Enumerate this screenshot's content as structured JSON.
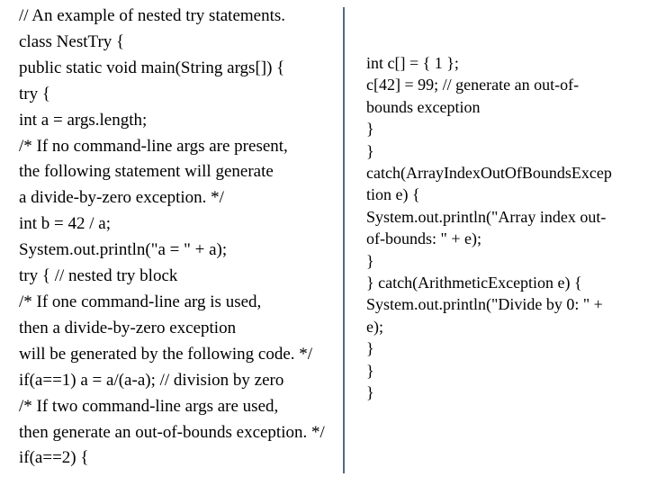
{
  "slide": {
    "left_column": {
      "lines": [
        "// An example of nested try statements.",
        "class NestTry {",
        "public static void main(String args[]) {",
        "try {",
        "int a = args.length;",
        "/* If no command-line args are present,",
        "the following statement will generate",
        "a divide-by-zero exception. */",
        "int b = 42 / a;",
        "System.out.println(\"a = \" + a);",
        "try { // nested try block",
        "/* If one command-line arg is used,",
        "then a divide-by-zero exception",
        "will be generated by the following code. */",
        "if(a==1) a = a/(a-a); // division by zero",
        "/* If two command-line args are used,",
        "then generate an out-of-bounds exception. */",
        "if(a==2) {"
      ]
    },
    "right_column": {
      "lines": [
        "int c[] = { 1 };",
        "c[42] = 99; // generate an out-of-",
        "bounds exception",
        "}",
        "}",
        "catch(ArrayIndexOutOfBoundsExcep",
        "tion e) {",
        "System.out.println(\"Array index out-",
        "of-bounds: \" + e);",
        "}",
        "} catch(ArithmeticException e) {",
        "System.out.println(\"Divide by 0: \" +",
        "e);",
        "}",
        "}",
        "}"
      ]
    },
    "divider_color": "#4f6b84"
  }
}
